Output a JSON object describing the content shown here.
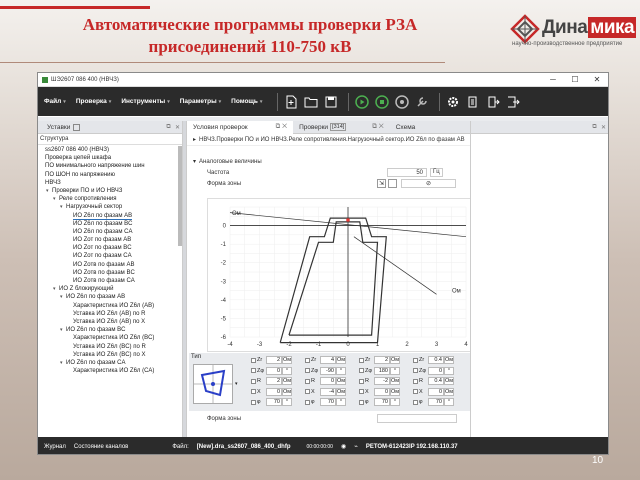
{
  "slide": {
    "title_line1": "Автоматические программы проверки РЗА",
    "title_line2": "присоединений 110-750 кВ",
    "logo_word": "Дина",
    "logo_word_hl": "мика",
    "logo_sub": "научно-производственное предприятие",
    "page_number": "10"
  },
  "window": {
    "title": "ШЭ2607 086 400 (НВЧЗ)",
    "min": "─",
    "max": "☐",
    "close": "✕"
  },
  "menu": [
    "Файл",
    "Проверка",
    "Инструменты",
    "Параметры",
    "Помощь"
  ],
  "toolbar_icons": [
    "new-file-icon",
    "open-folder-icon",
    "save-icon",
    "start-icon",
    "stop-icon",
    "record-icon",
    "wrench-icon",
    "settings-icon",
    "document-icon",
    "export-icon",
    "exit-icon"
  ],
  "left_panel": {
    "title": "Уставки",
    "subtitle": "Структура",
    "tree": [
      {
        "label": "ss2607 086 400 (НВЧЗ)",
        "indent": 0,
        "toggle": ""
      },
      {
        "label": "Проверка цепей шкафа",
        "indent": 0,
        "toggle": ""
      },
      {
        "label": "ПО минимального напряжение шин",
        "indent": 0,
        "toggle": ""
      },
      {
        "label": "ПО ШОН по напряжению",
        "indent": 0,
        "toggle": ""
      },
      {
        "label": "НВЧЗ",
        "indent": 0,
        "toggle": ""
      },
      {
        "label": "Проверки ПО и ИО НВЧЗ",
        "indent": 1,
        "toggle": "▾"
      },
      {
        "label": "Реле сопротивления",
        "indent": 2,
        "toggle": "▾"
      },
      {
        "label": "Нагрузочный сектор",
        "indent": 3,
        "toggle": "▾"
      },
      {
        "label": "ИО Z6л по фазам AB",
        "indent": 4,
        "toggle": "",
        "selected": true
      },
      {
        "label": "ИО Z6л по фазам BC",
        "indent": 4,
        "toggle": ""
      },
      {
        "label": "ИО Z6л по фазам CA",
        "indent": 4,
        "toggle": ""
      },
      {
        "label": "ИО Zот по фазам AB",
        "indent": 4,
        "toggle": ""
      },
      {
        "label": "ИО Zот по фазам BC",
        "indent": 4,
        "toggle": ""
      },
      {
        "label": "ИО Zот по фазам CA",
        "indent": 4,
        "toggle": ""
      },
      {
        "label": "ИО Zотв по фазам AB",
        "indent": 4,
        "toggle": ""
      },
      {
        "label": "ИО Zотв по фазам BC",
        "indent": 4,
        "toggle": ""
      },
      {
        "label": "ИО Zотв по фазам CA",
        "indent": 4,
        "toggle": ""
      },
      {
        "label": "ИО Z блокирующий",
        "indent": 2,
        "toggle": "▾"
      },
      {
        "label": "ИО Z6л по фазам AB",
        "indent": 3,
        "toggle": "▾"
      },
      {
        "label": "Характеристика ИО Z6л (AB)",
        "indent": 4,
        "toggle": ""
      },
      {
        "label": "Уставка ИО Z6л (AB) по R",
        "indent": 4,
        "toggle": ""
      },
      {
        "label": "Уставка ИО Z6л (AB) по X",
        "indent": 4,
        "toggle": ""
      },
      {
        "label": "ИО Z6л по фазам BC",
        "indent": 3,
        "toggle": "▾"
      },
      {
        "label": "Характеристика ИО Z6л (BC)",
        "indent": 4,
        "toggle": ""
      },
      {
        "label": "Уставка ИО Z6л (BC) по R",
        "indent": 4,
        "toggle": ""
      },
      {
        "label": "Уставка ИО Z6л (BC) по X",
        "indent": 4,
        "toggle": ""
      },
      {
        "label": "ИО Z6л по фазам CA",
        "indent": 3,
        "toggle": "▾"
      },
      {
        "label": "Характеристика ИО Z6л (CA)",
        "indent": 4,
        "toggle": ""
      }
    ]
  },
  "mid_panel": {
    "tabs": [
      "Условия проверок",
      "Проверки",
      "Схема"
    ],
    "tab_badge": "[314]",
    "breadcrumb": "НВЧЗ.Проверки ПО и ИО НВЧЗ.Реле сопротивления.Нагрузочный сектор.ИО Z6л по фазам AB",
    "section_analog": "Аналоговые величины",
    "freq_label": "Частота",
    "freq_value": "50",
    "freq_unit": "Гц",
    "zone_label": "Форма зоны",
    "zone_label2": "Форма зоны",
    "tip_label": "Тип",
    "axis_y": "Ом",
    "axis_x": "Ом"
  },
  "params": [
    {
      "rows": [
        {
          "n": "Zr",
          "v": "2",
          "u": "Ом"
        },
        {
          "n": "Zφ",
          "v": "0",
          "u": "°"
        },
        {
          "n": "R",
          "v": "2",
          "u": "Ом"
        },
        {
          "n": "X",
          "v": "0",
          "u": "Ом"
        },
        {
          "n": "φ",
          "v": "70",
          "u": "°"
        }
      ]
    },
    {
      "rows": [
        {
          "n": "Zr",
          "v": "4",
          "u": "Ом"
        },
        {
          "n": "Zφ",
          "v": "-90",
          "u": "°"
        },
        {
          "n": "R",
          "v": "0",
          "u": "Ом"
        },
        {
          "n": "X",
          "v": "-4",
          "u": "Ом"
        },
        {
          "n": "φ",
          "v": "70",
          "u": "°"
        }
      ]
    },
    {
      "rows": [
        {
          "n": "Zr",
          "v": "2",
          "u": "Ом"
        },
        {
          "n": "Zφ",
          "v": "180",
          "u": "°"
        },
        {
          "n": "R",
          "v": "-2",
          "u": "Ом"
        },
        {
          "n": "X",
          "v": "0",
          "u": "Ом"
        },
        {
          "n": "φ",
          "v": "70",
          "u": "°"
        }
      ]
    },
    {
      "rows": [
        {
          "n": "Zr",
          "v": "0.4",
          "u": "Ом"
        },
        {
          "n": "Zφ",
          "v": "0",
          "u": "°"
        },
        {
          "n": "R",
          "v": "0.4",
          "u": "Ом"
        },
        {
          "n": "X",
          "v": "0",
          "u": "Ом"
        },
        {
          "n": "φ",
          "v": "70",
          "u": "°"
        }
      ]
    }
  ],
  "statusbar": {
    "journal": "Журнал",
    "channels": "Состояние каналов",
    "file_label": "Файл:",
    "file_value": "[New].dra_ss2607_086_400_dhfp",
    "time": "00:00:00:00",
    "device": "РЕТОМ-61",
    "code": "2423",
    "ip": "IP 192.168.110.37"
  },
  "chart_data": {
    "type": "line",
    "title": "",
    "xlabel": "Ом",
    "ylabel": "Ом",
    "xlim": [
      -4,
      4
    ],
    "ylim": [
      -6,
      1
    ],
    "x_ticks": [
      "-4",
      "-3",
      "-2",
      "-1",
      "0",
      "1",
      "2",
      "3",
      "4"
    ],
    "y_ticks": [
      "0",
      "-1",
      "-2",
      "-3",
      "-4",
      "-5",
      "-6"
    ],
    "grid": true,
    "series": [
      {
        "values": [
          [
            -2.3,
            -6.3
          ],
          [
            -1.3,
            -0.6
          ],
          [
            -0.8,
            -0.6
          ],
          [
            -0.6,
            0.4
          ],
          [
            0.6,
            0.4
          ],
          [
            0.8,
            -0.6
          ],
          [
            1.3,
            -0.6
          ],
          [
            1.0,
            -6.3
          ],
          [
            -2.3,
            -6.3
          ]
        ]
      },
      {
        "values": [
          [
            -2.0,
            -5.9
          ],
          [
            -1.0,
            -0.9
          ],
          [
            -0.5,
            -0.9
          ],
          [
            -0.4,
            0.2
          ],
          [
            0.4,
            0.2
          ],
          [
            0.5,
            -0.9
          ],
          [
            1.0,
            -0.9
          ],
          [
            0.8,
            -5.9
          ],
          [
            -2.0,
            -5.9
          ]
        ]
      },
      {
        "values": [
          [
            -4,
            0.7
          ],
          [
            4,
            -0.6
          ]
        ]
      },
      {
        "values": [
          [
            0.2,
            -0.6
          ],
          [
            3.0,
            -3.7
          ]
        ]
      }
    ],
    "markers": [
      [
        0,
        0.3
      ]
    ]
  }
}
